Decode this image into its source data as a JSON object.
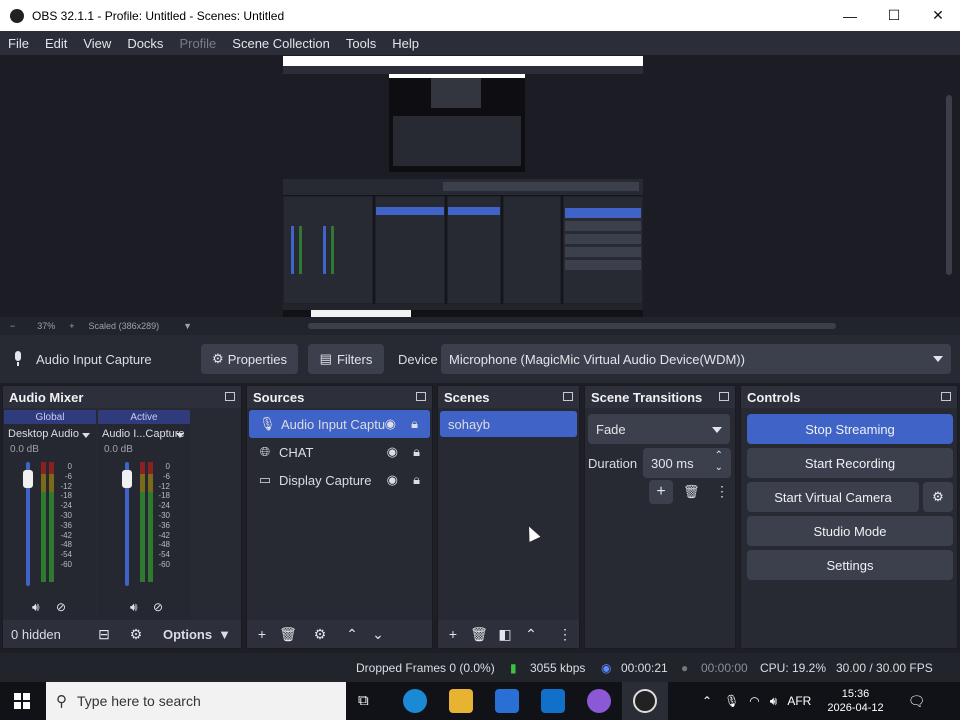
{
  "window": {
    "title": "OBS 32.1.1 - Profile: Untitled - Scenes: Untitled"
  },
  "menu": [
    "File",
    "Edit",
    "View",
    "Docks",
    "Profile",
    "Scene Collection",
    "Tools",
    "Help"
  ],
  "zoombar": {
    "minus": "−",
    "percent": "37%",
    "plus": "+",
    "scaled": "Scaled (386x289)"
  },
  "context": {
    "source": "Audio Input Capture",
    "properties": "Properties",
    "filters": "Filters",
    "device_label": "Device",
    "device_value": "Microphone (MagicMic Virtual Audio Device(WDM))"
  },
  "mixer": {
    "title": "Audio Mixer",
    "channels": [
      {
        "head": "Global",
        "name": "Desktop Audio",
        "db": "0.0 dB"
      },
      {
        "head": "Active",
        "name": "Audio I...Capture",
        "db": "0.0 dB"
      }
    ],
    "ticks": [
      "0",
      "-6",
      "-12",
      "-18",
      "-24",
      "-30",
      "-36",
      "-42",
      "-48",
      "-54",
      "-60"
    ],
    "hidden": "0 hidden",
    "options": "Options"
  },
  "sources": {
    "title": "Sources",
    "items": [
      {
        "label": "Audio Input Captu"
      },
      {
        "label": "CHAT"
      },
      {
        "label": "Display Capture"
      }
    ]
  },
  "scenes": {
    "title": "Scenes",
    "items": [
      "sohayb"
    ]
  },
  "transitions": {
    "title": "Scene Transitions",
    "type": "Fade",
    "duration_label": "Duration",
    "duration_value": "300 ms"
  },
  "controls": {
    "title": "Controls",
    "stop_streaming": "Stop Streaming",
    "start_recording": "Start Recording",
    "start_virtual_camera": "Start Virtual Camera",
    "studio_mode": "Studio Mode",
    "settings": "Settings"
  },
  "status": {
    "dropped_frames": "Dropped Frames 0 (0.0%)",
    "bitrate": "3055 kbps",
    "stream_time": "00:00:21",
    "record_time": "00:00:00",
    "cpu": "CPU: 19.2%",
    "fps": "30.00 / 30.00 FPS"
  },
  "taskbar": {
    "search_placeholder": "Type here to search",
    "lang": "AFR",
    "time": "15:36",
    "date": "2026-04-12"
  },
  "colors": {
    "accent": "#3f63c7",
    "panel": "#272a33",
    "stream_green": "#3cc43c"
  }
}
